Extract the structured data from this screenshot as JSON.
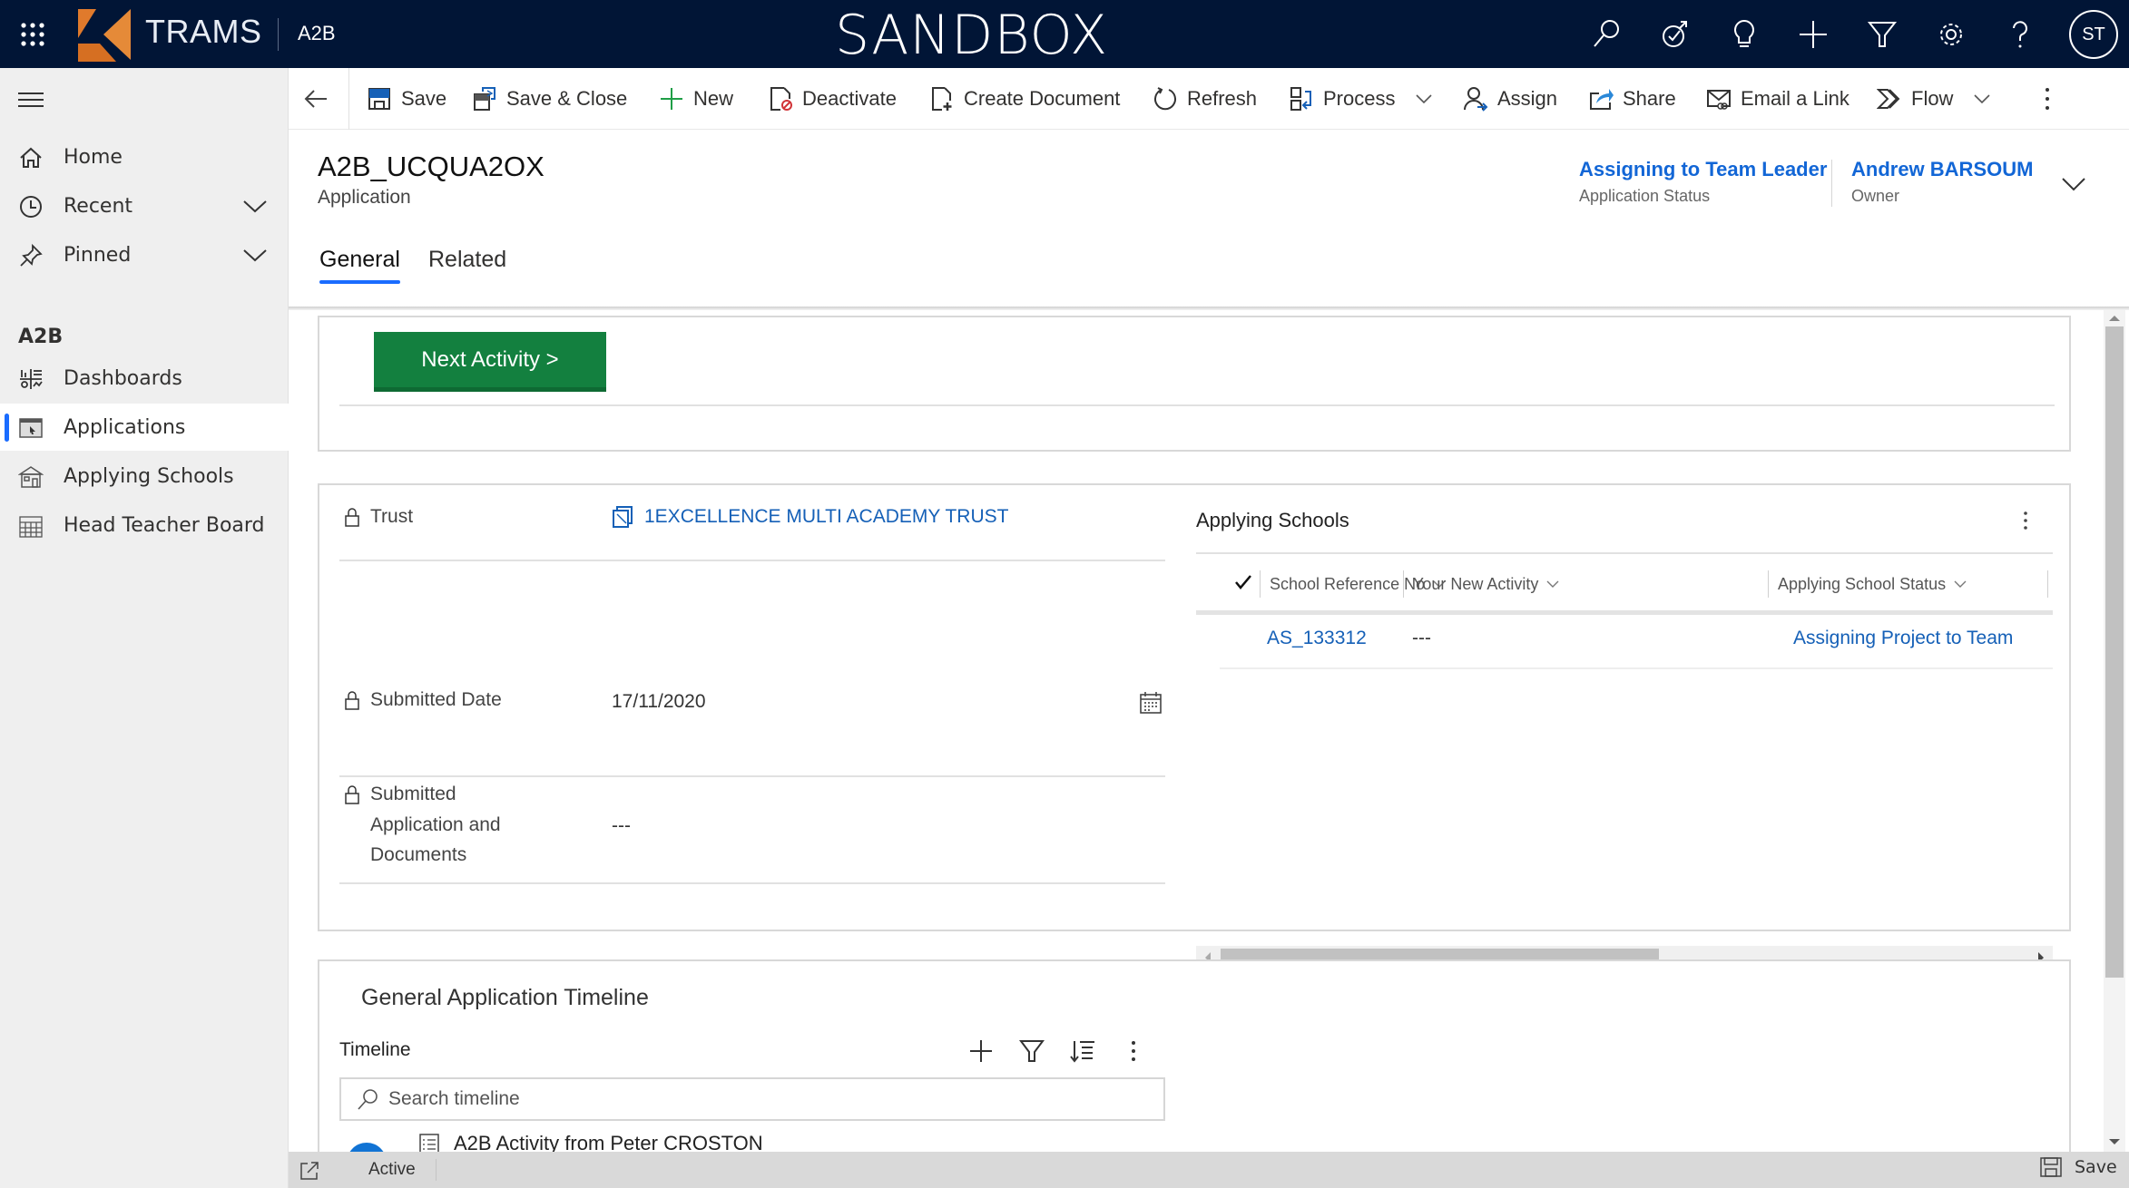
{
  "topbar": {
    "brand": "TRAMS",
    "app_name": "A2B",
    "environment": "SANDBOX",
    "icons": [
      "search-icon",
      "task-flow-icon",
      "lightbulb-icon",
      "plus-icon",
      "filter-icon",
      "gear-icon",
      "help-icon"
    ],
    "user_initials": "ST",
    "brand_colors": {
      "navy": "#011536",
      "logo_orange": "#e0782a"
    }
  },
  "sidebar": {
    "items": [
      {
        "label": "Home",
        "icon": "home-icon"
      },
      {
        "label": "Recent",
        "icon": "clock-icon",
        "expandable": true
      },
      {
        "label": "Pinned",
        "icon": "pin-icon",
        "expandable": true
      }
    ],
    "group_label": "A2B",
    "group_items": [
      {
        "label": "Dashboards",
        "icon": "dashboard-icon",
        "active": false
      },
      {
        "label": "Applications",
        "icon": "application-icon",
        "active": true
      },
      {
        "label": "Applying Schools",
        "icon": "school-icon",
        "active": false
      },
      {
        "label": "Head Teacher Board",
        "icon": "board-icon",
        "active": false
      }
    ],
    "active_color": "#1a6cff"
  },
  "commandbar": {
    "back_icon": "back-arrow-icon",
    "commands": [
      {
        "label": "Save",
        "icon": "save-icon"
      },
      {
        "label": "Save & Close",
        "icon": "save-close-icon"
      },
      {
        "label": "New",
        "icon": "plus-icon"
      },
      {
        "label": "Deactivate",
        "icon": "deactivate-icon"
      },
      {
        "label": "Create Document",
        "icon": "create-document-icon"
      },
      {
        "label": "Refresh",
        "icon": "refresh-icon"
      },
      {
        "label": "Process",
        "icon": "process-icon",
        "has_dropdown": true
      },
      {
        "label": "Assign",
        "icon": "assign-icon"
      },
      {
        "label": "Share",
        "icon": "share-icon"
      },
      {
        "label": "Email a Link",
        "icon": "email-link-icon"
      },
      {
        "label": "Flow",
        "icon": "flow-icon",
        "has_dropdown": true
      }
    ],
    "more_icon": "more-vertical-icon"
  },
  "record": {
    "title": "A2B_UCQUA2OX",
    "entity": "Application",
    "header_fields": [
      {
        "value": "Assigning to Team Leader",
        "label": "Application Status"
      },
      {
        "value": "Andrew BARSOUM",
        "label": "Owner"
      }
    ],
    "tabs": [
      {
        "label": "General",
        "active": true
      },
      {
        "label": "Related",
        "active": false
      }
    ]
  },
  "actions": {
    "next_activity_label": "Next Activity >",
    "button_color": "#13803f"
  },
  "details": {
    "trust": {
      "label": "Trust",
      "value": "1EXCELLENCE MULTI ACADEMY TRUST",
      "locked": true
    },
    "submitted_date": {
      "label": "Submitted Date",
      "value": "17/11/2020",
      "locked": true
    },
    "submitted_docs": {
      "label_lines": [
        "Submitted",
        "Application and",
        "Documents"
      ],
      "value": "---",
      "locked": true
    }
  },
  "applying_schools": {
    "title": "Applying Schools",
    "columns": [
      "School Reference No",
      "Your New Activity",
      "Applying School Status"
    ],
    "rows": [
      {
        "school_reference_no": "AS_133312",
        "your_new_activity": "---",
        "applying_school_status": "Assigning Project to Team"
      }
    ],
    "horizontal_scroll_fraction": 0.35
  },
  "timeline": {
    "section_title": "General Application Timeline",
    "label": "Timeline",
    "toolbar_icons": [
      "plus-icon",
      "filter-icon",
      "sort-icon",
      "more-vertical-icon"
    ],
    "search_placeholder": "Search timeline",
    "entries": [
      {
        "title": "A2B Activity from Peter CROSTON"
      }
    ]
  },
  "statusbar": {
    "state": "Active",
    "save_label": "Save"
  }
}
